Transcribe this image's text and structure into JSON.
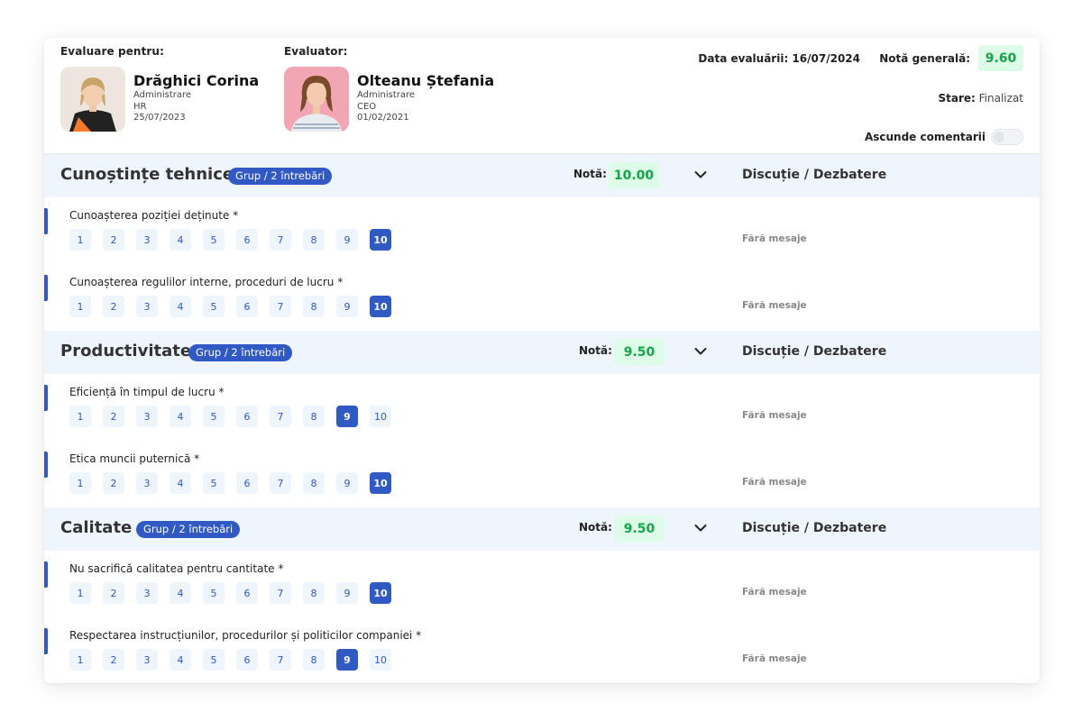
{
  "header": {
    "evaluated_label": "Evaluare pentru:",
    "evaluated": {
      "name": "Drăghici Corina",
      "role": "Administrare",
      "department": "HR",
      "date": "25/07/2023"
    },
    "evaluator_label": "Evaluator:",
    "evaluator": {
      "name": "Olteanu Ștefania",
      "role": "Administrare",
      "department": "CEO",
      "date": "01/02/2021"
    },
    "eval_date": "Data evaluării: 16/07/2024",
    "general_grade_label": "Notă generală:",
    "general_grade_value": "9.60",
    "status_label": "Stare:",
    "status_value": "Finalizat",
    "hide_comments_label": "Ascunde comentarii",
    "hide_comments_on": false
  },
  "scale": [
    "1",
    "2",
    "3",
    "4",
    "5",
    "6",
    "7",
    "8",
    "9",
    "10"
  ],
  "groups": [
    {
      "title": "Cunoștințe tehnice",
      "badge": "Grup / 2 întrebări",
      "grade_label": "Notă:",
      "grade": "10.00",
      "discussion": "Discuție / Dezbatere",
      "questions": [
        {
          "label": "Cunoașterea poziției deținute *",
          "selected": "10",
          "messages": "Fără mesaje"
        },
        {
          "label": "Cunoașterea regulilor interne, proceduri de lucru *",
          "selected": "10",
          "messages": "Fără mesaje"
        }
      ]
    },
    {
      "title": "Productivitate",
      "badge": "Grup / 2 întrebări",
      "grade_label": "Notă:",
      "grade": "9.50",
      "discussion": "Discuție / Dezbatere",
      "questions": [
        {
          "label": "Eficiență în timpul de lucru *",
          "selected": "9",
          "messages": "Fără mesaje"
        },
        {
          "label": "Etica muncii puternică *",
          "selected": "10",
          "messages": "Fără mesaje"
        }
      ]
    },
    {
      "title": "Calitate",
      "badge": "Grup / 2 întrebări",
      "grade_label": "Notă:",
      "grade": "9.50",
      "discussion": "Discuție / Dezbatere",
      "questions": [
        {
          "label": "Nu sacrifică calitatea pentru cantitate *",
          "selected": "10",
          "messages": "Fără mesaje"
        },
        {
          "label": "Respectarea instrucțiunilor, procedurilor și politicilor companiei *",
          "selected": "9",
          "messages": "Fără mesaje"
        }
      ]
    }
  ],
  "colors": {
    "accent": "#3159c4",
    "grade_bg": "#dcfce7",
    "grade_text": "#16a34a",
    "group_bg": "#eef5fd"
  }
}
